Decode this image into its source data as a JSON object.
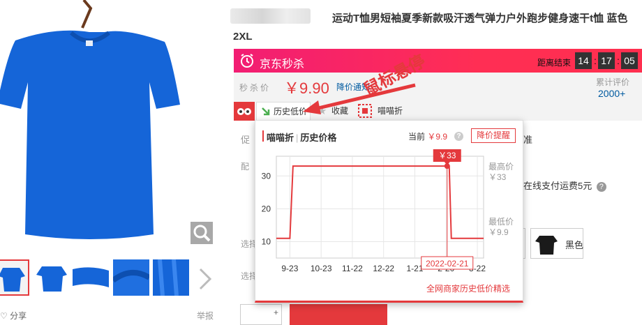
{
  "product": {
    "title": "运动T恤男短袖夏季新款吸汗透气弹力户外跑步健身速干t恤 蓝色 2XL"
  },
  "gallery": {
    "share_label": "分享",
    "report_label": "举报",
    "thumbnail_count": 5,
    "selected_thumbnail": 1
  },
  "flash_sale": {
    "label": "京东秒杀",
    "countdown_label": "距离结束",
    "hours": "14",
    "minutes": "17",
    "seconds": "05"
  },
  "price": {
    "label": "秒杀价",
    "value": "￥9.90",
    "notify_label": "降价通知",
    "reviews_label": "累计评价",
    "reviews_count": "2000+"
  },
  "tabs": [
    {
      "label": "历史低价"
    },
    {
      "label": "收藏"
    },
    {
      "label": "喵喵折"
    }
  ],
  "rows": {
    "promo_label": "促",
    "deliver_label": "配",
    "shipping_text": "在线支付运费5元",
    "color_label": "选择",
    "size_label": "选择",
    "color_option": "黑色",
    "qty_plus": "+"
  },
  "popup": {
    "brand": "喵喵折",
    "title": "历史价格",
    "current_label": "当前",
    "current_price": "￥9.9",
    "alert_button": "降价提醒",
    "high_label": "最高价",
    "high_value": "￥33",
    "low_label": "最低价",
    "low_value": "￥9.9",
    "footer": "全网商家历史低价精选",
    "tooltip_price": "￥33",
    "tooltip_date": "2022-02-21"
  },
  "annotation": "鼠标悬停",
  "colors": {
    "accent": "#e4393c",
    "flash_start": "#f21d73",
    "flash_end": "#ff2f4f",
    "link": "#005aa0"
  },
  "chart_data": {
    "type": "line",
    "x_ticks": [
      "9-23",
      "10-23",
      "11-22",
      "12-22",
      "1-21",
      "2-20",
      "3-22"
    ],
    "y_ticks": [
      10,
      20,
      30
    ],
    "ylim": [
      5,
      36
    ],
    "x": [
      "9-10",
      "9-23",
      "9-26",
      "2-21",
      "2-23",
      "2-25",
      "3-22",
      "3-28"
    ],
    "y": [
      11,
      11,
      33,
      33,
      33,
      11,
      11,
      11
    ],
    "highlight": {
      "x": "2-21",
      "y": 33
    }
  }
}
